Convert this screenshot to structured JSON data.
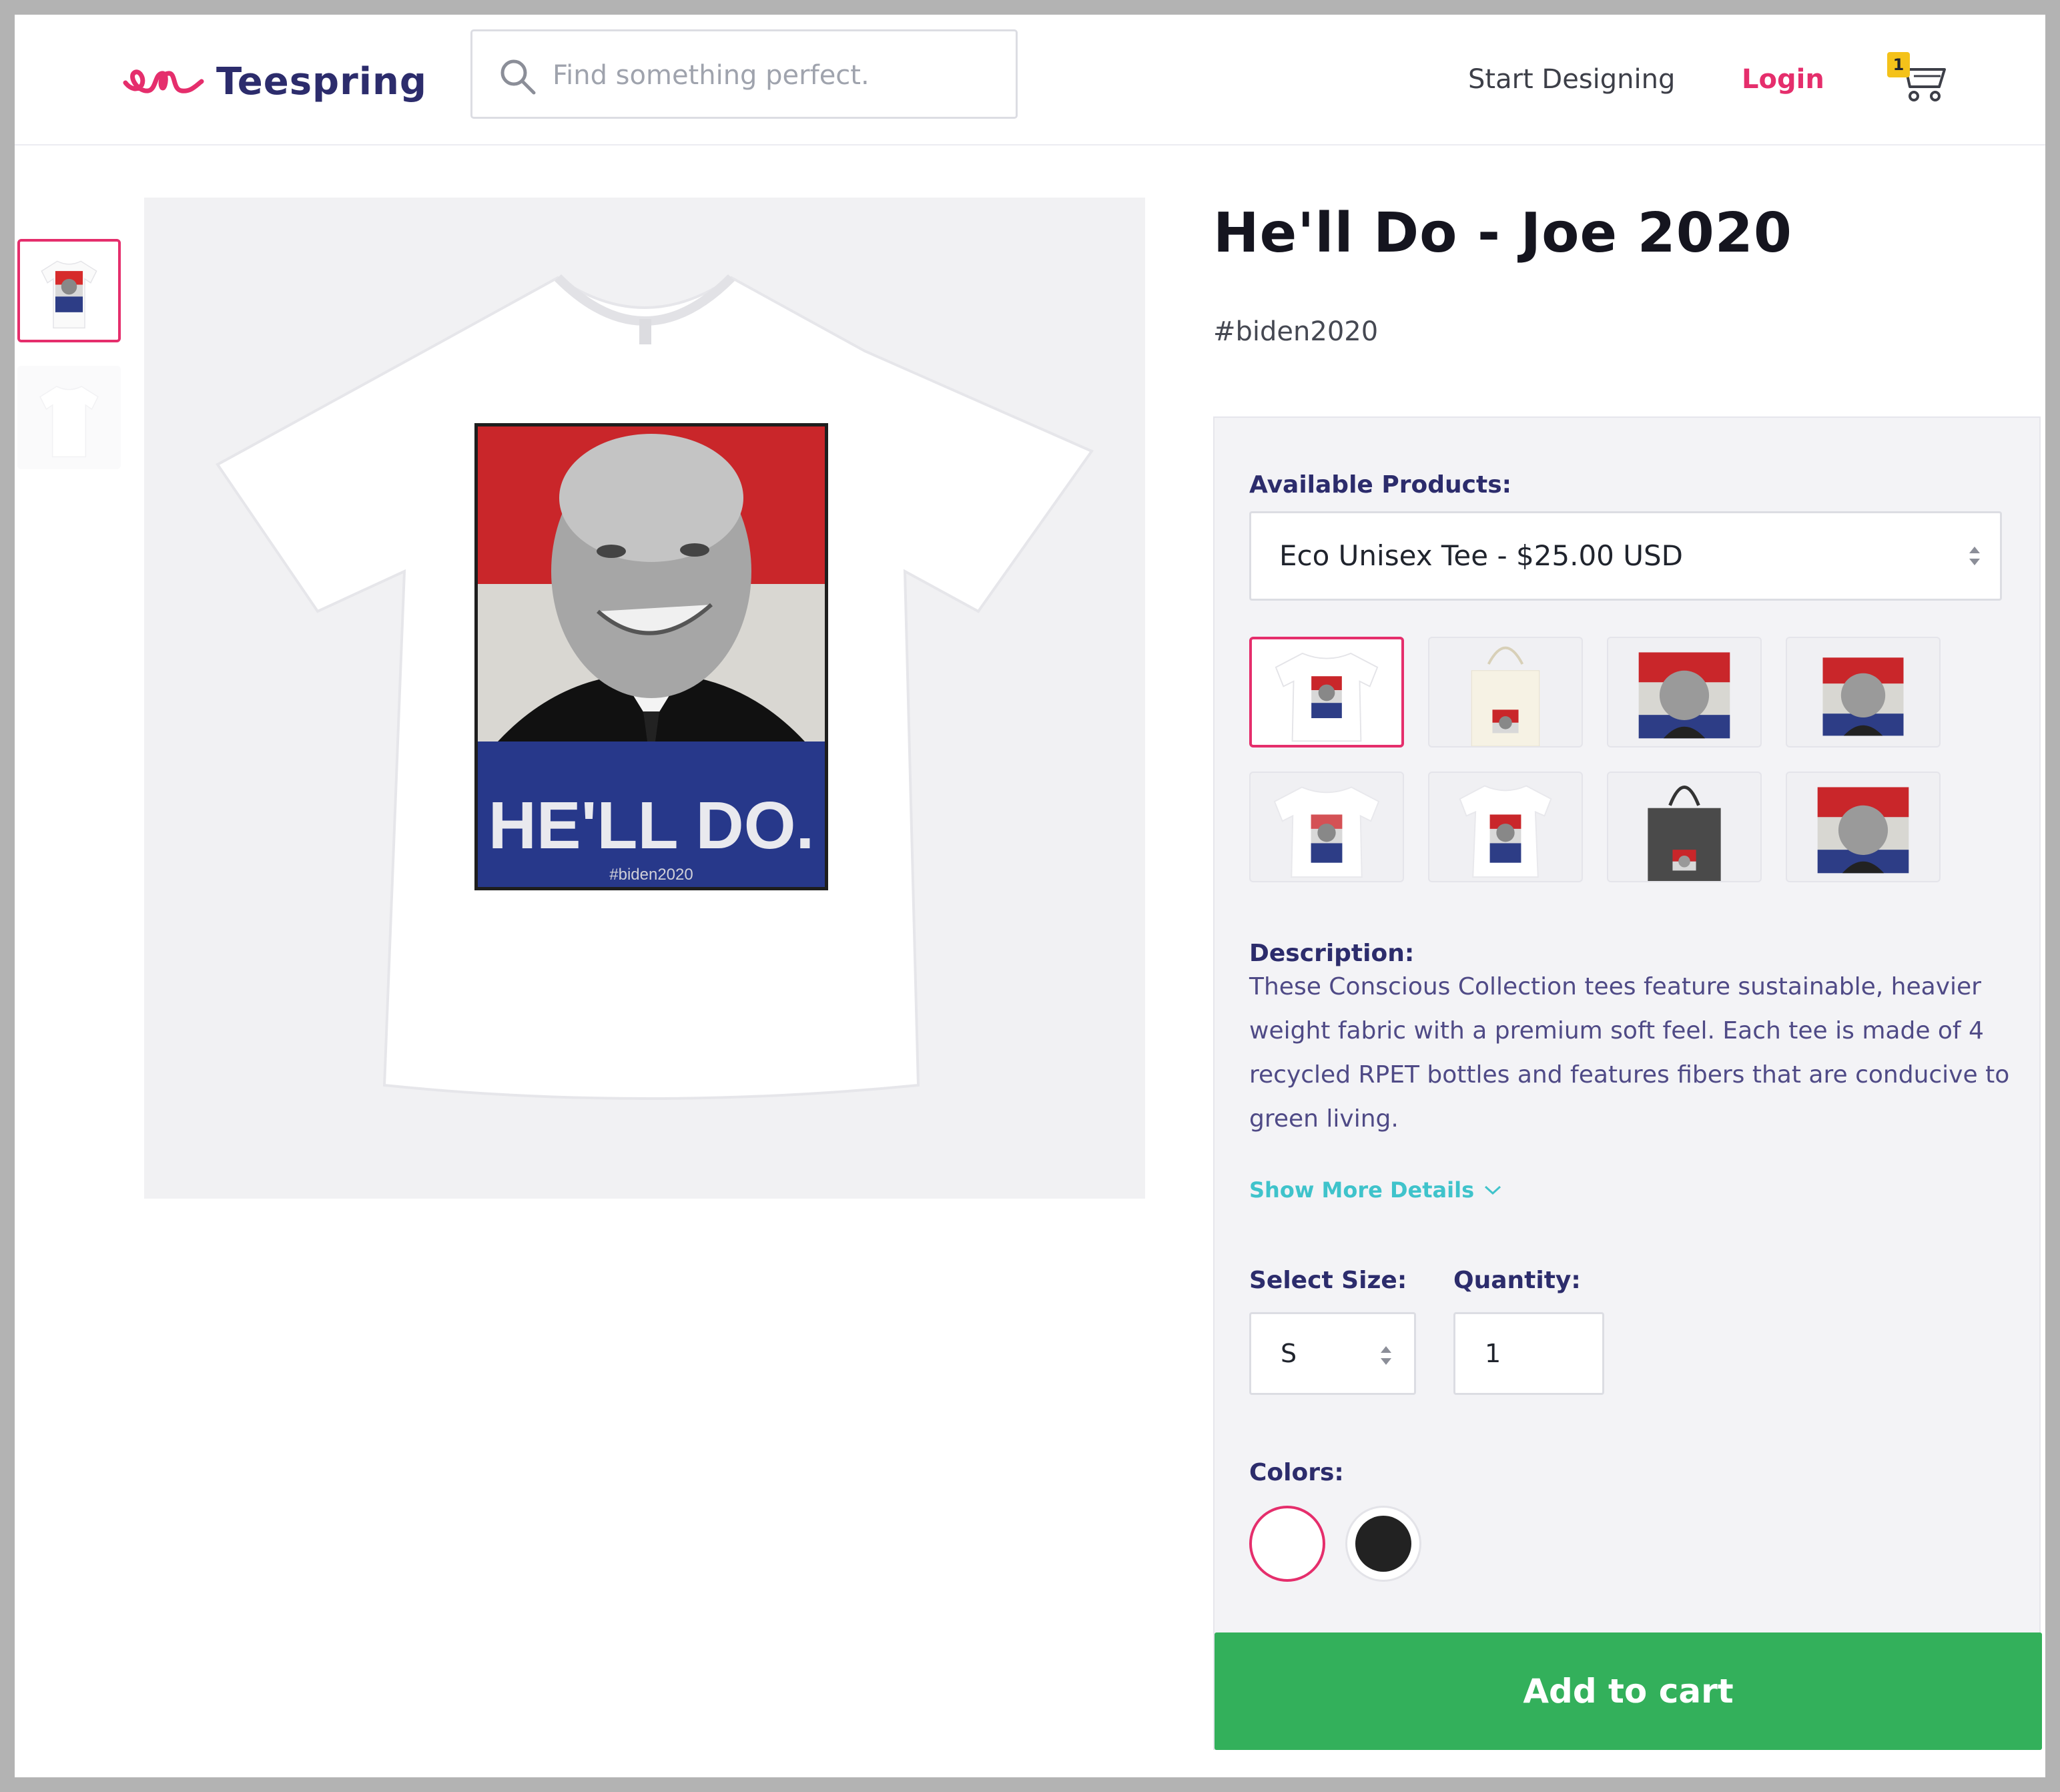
{
  "header": {
    "logo_text": "Teespring",
    "search_placeholder": "Find something perfect.",
    "start_designing": "Start Designing",
    "login": "Login",
    "cart_count": "1"
  },
  "product": {
    "title": "He'll Do - Joe 2020",
    "tag": "#biden2020",
    "design_headline": "HE'LL DO.",
    "design_hashtag": "#biden2020"
  },
  "panel": {
    "available_label": "Available Products:",
    "selected_product": "Eco Unisex Tee - $25.00 USD",
    "description_label": "Description:",
    "description": "These Conscious Collection tees feature sustainable, heavier weight fabric with a premium soft feel. Each tee is made of 4 recycled RPET bottles and features fibers that are conducive to green living.",
    "show_more": "Show More Details",
    "size_label": "Select Size:",
    "size_value": "S",
    "quantity_label": "Quantity:",
    "quantity_value": "1",
    "colors_label": "Colors:",
    "colors": [
      "#ffffff",
      "#222222"
    ],
    "add_to_cart": "Add to cart"
  },
  "product_variants": [
    "eco-unisex-tee",
    "tote-bag-natural",
    "poster",
    "framed-print",
    "classic-tee",
    "womens-tee",
    "tote-bag-black",
    "canvas-print"
  ],
  "brand_colors": {
    "accent": "#e52e6c",
    "navy": "#2c2c6c",
    "link": "#3fc3cb",
    "cta": "#33b05b",
    "badge": "#f4c21a"
  }
}
